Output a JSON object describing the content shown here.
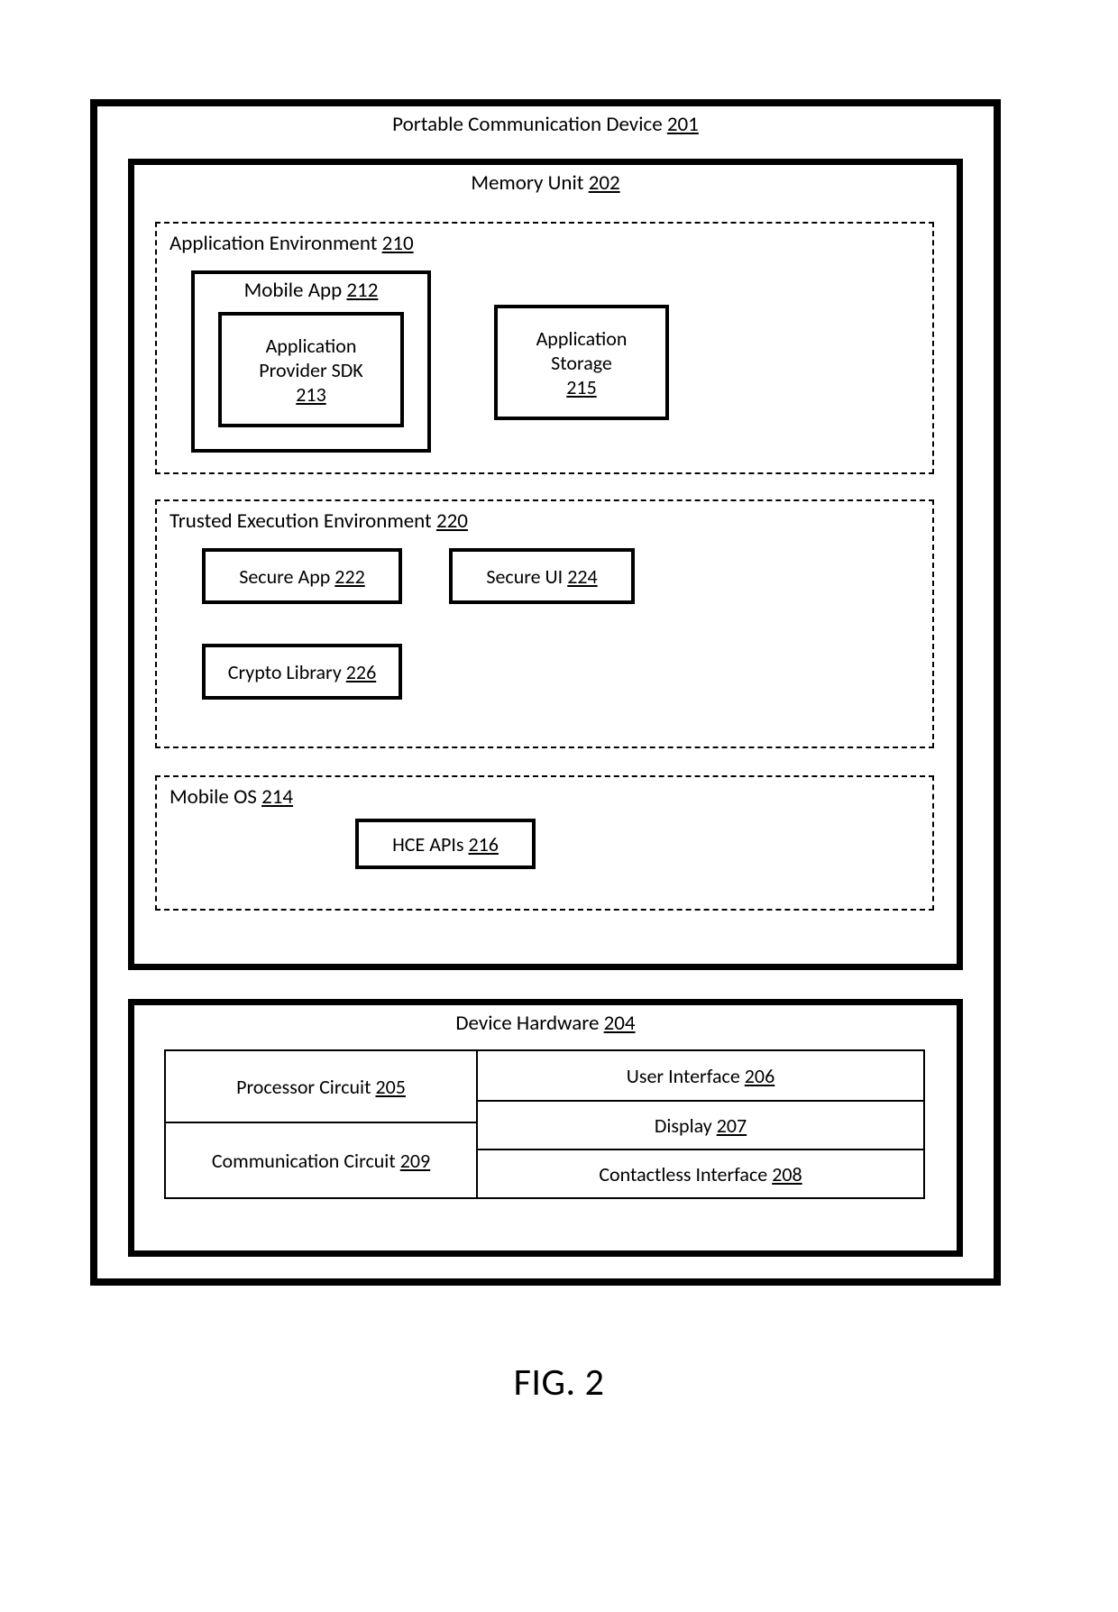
{
  "figure_caption": "FIG. 2",
  "device": {
    "label": "Portable Communication Device",
    "ref": "201"
  },
  "memory": {
    "label": "Memory Unit",
    "ref": "202"
  },
  "app_env": {
    "label": "Application Environment",
    "ref": "210"
  },
  "mobile_app": {
    "label": "Mobile App",
    "ref": "212"
  },
  "provider_sdk": {
    "label_l1": "Application",
    "label_l2": "Provider SDK",
    "ref": "213"
  },
  "app_storage": {
    "label_l1": "Application",
    "label_l2": "Storage",
    "ref": "215"
  },
  "tee": {
    "label": "Trusted Execution Environment",
    "ref": "220"
  },
  "secure_app": {
    "label": "Secure App",
    "ref": "222"
  },
  "secure_ui": {
    "label": "Secure UI",
    "ref": "224"
  },
  "crypto_lib": {
    "label": "Crypto Library",
    "ref": "226"
  },
  "mobile_os": {
    "label": "Mobile OS",
    "ref": "214"
  },
  "hce_apis": {
    "label": "HCE APIs",
    "ref": "216"
  },
  "hardware": {
    "label": "Device Hardware",
    "ref": "204"
  },
  "proc": {
    "label": "Processor Circuit",
    "ref": "205"
  },
  "comm": {
    "label": "Communication Circuit",
    "ref": "209"
  },
  "ui": {
    "label": "User Interface",
    "ref": "206"
  },
  "display": {
    "label": "Display",
    "ref": "207"
  },
  "contactless": {
    "label": "Contactless Interface",
    "ref": "208"
  }
}
